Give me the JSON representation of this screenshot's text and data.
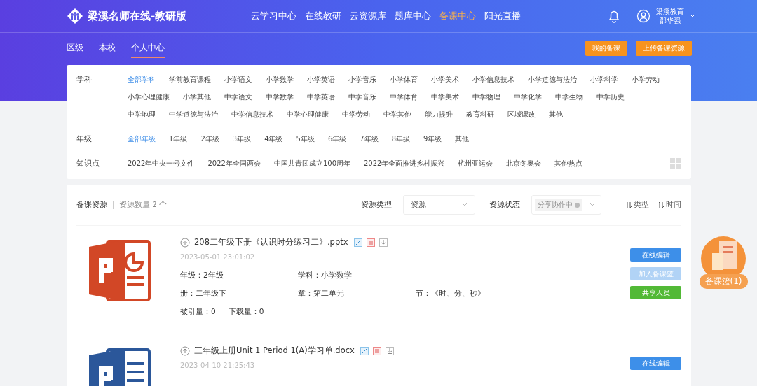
{
  "header": {
    "logo_text": "梁溪名师在线-教研版",
    "nav": [
      {
        "label": "云学习中心",
        "selected": false
      },
      {
        "label": "在线教研",
        "selected": false
      },
      {
        "label": "云资源库",
        "selected": false
      },
      {
        "label": "题库中心",
        "selected": false
      },
      {
        "label": "备课中心",
        "selected": true
      },
      {
        "label": "阳光直播",
        "selected": false
      }
    ],
    "user": {
      "org": "梁溪教育",
      "name": "邵华强"
    }
  },
  "subnav": {
    "tabs": [
      {
        "label": "区级",
        "selected": false
      },
      {
        "label": "本校",
        "selected": false
      },
      {
        "label": "个人中心",
        "selected": true
      }
    ],
    "actions": [
      "我的备课",
      "上传备课资源"
    ]
  },
  "filters": [
    {
      "label": "学科",
      "options": [
        {
          "label": "全部学科",
          "selected": true
        },
        {
          "label": "学前教育课程",
          "selected": false
        },
        {
          "label": "小学语文",
          "selected": false
        },
        {
          "label": "小学数学",
          "selected": false
        },
        {
          "label": "小学英语",
          "selected": false
        },
        {
          "label": "小学音乐",
          "selected": false
        },
        {
          "label": "小学体育",
          "selected": false
        },
        {
          "label": "小学美术",
          "selected": false
        },
        {
          "label": "小学信息技术",
          "selected": false
        },
        {
          "label": "小学道德与法治",
          "selected": false
        },
        {
          "label": "小学科学",
          "selected": false
        },
        {
          "label": "小学劳动",
          "selected": false
        },
        {
          "label": "小学心理健康",
          "selected": false
        },
        {
          "label": "小学其他",
          "selected": false
        },
        {
          "label": "中学语文",
          "selected": false
        },
        {
          "label": "中学数学",
          "selected": false
        },
        {
          "label": "中学英语",
          "selected": false
        },
        {
          "label": "中学音乐",
          "selected": false
        },
        {
          "label": "中学体育",
          "selected": false
        },
        {
          "label": "中学美术",
          "selected": false
        },
        {
          "label": "中学物理",
          "selected": false
        },
        {
          "label": "中学化学",
          "selected": false
        },
        {
          "label": "中学生物",
          "selected": false
        },
        {
          "label": "中学历史",
          "selected": false
        },
        {
          "label": "中学地理",
          "selected": false
        },
        {
          "label": "中学道德与法治",
          "selected": false
        },
        {
          "label": "中学信息技术",
          "selected": false
        },
        {
          "label": "中学心理健康",
          "selected": false
        },
        {
          "label": "中学劳动",
          "selected": false
        },
        {
          "label": "中学其他",
          "selected": false
        },
        {
          "label": "能力提升",
          "selected": false
        },
        {
          "label": "教育科研",
          "selected": false
        },
        {
          "label": "区域课改",
          "selected": false
        },
        {
          "label": "其他",
          "selected": false
        }
      ]
    },
    {
      "label": "年级",
      "options": [
        {
          "label": "全部年级",
          "selected": true
        },
        {
          "label": "1年级",
          "selected": false
        },
        {
          "label": "2年级",
          "selected": false
        },
        {
          "label": "3年级",
          "selected": false
        },
        {
          "label": "4年级",
          "selected": false
        },
        {
          "label": "5年级",
          "selected": false
        },
        {
          "label": "6年级",
          "selected": false
        },
        {
          "label": "7年级",
          "selected": false
        },
        {
          "label": "8年级",
          "selected": false
        },
        {
          "label": "9年级",
          "selected": false
        },
        {
          "label": "其他",
          "selected": false
        }
      ]
    },
    {
      "label": "知识点",
      "options": [
        {
          "label": "2022年中央一号文件",
          "selected": false
        },
        {
          "label": "2022年全国两会",
          "selected": false
        },
        {
          "label": "中国共青团成立100周年",
          "selected": false
        },
        {
          "label": "2022年全面推进乡村振兴",
          "selected": false
        },
        {
          "label": "杭州亚运会",
          "selected": false
        },
        {
          "label": "北京冬奥会",
          "selected": false
        },
        {
          "label": "其他热点",
          "selected": false
        }
      ]
    }
  ],
  "toolbar": {
    "title": "备课资源",
    "count": "资源数量 2 个",
    "type_label": "资源类型",
    "type_value": "资源",
    "status_label": "资源状态",
    "status_chip": "分享协作中",
    "sorts": [
      "类型",
      "时间"
    ]
  },
  "resources": [
    {
      "kind": "pptx",
      "title": "208二年级下册《认识时分练习二》.pptx",
      "date": "2023-05-01 23:01:02",
      "rows": [
        [
          "年级：2年级",
          "学科：小学数学"
        ],
        [
          "册：二年级下",
          "章：第二单元",
          "节：《时、分、秒》"
        ],
        [
          "被引量：0",
          "下载量：0"
        ]
      ],
      "buttons": [
        {
          "label": "在线编辑",
          "kind": "edit"
        },
        {
          "label": "加入备课篮",
          "kind": "disabled"
        },
        {
          "label": "共享人员",
          "kind": "share"
        }
      ]
    },
    {
      "kind": "docx",
      "title": "三年级上册Unit 1 Period 1(A)学习单.docx",
      "date": "2023-04-10 21:25:43",
      "buttons": [
        {
          "label": "在线编辑",
          "kind": "edit"
        }
      ]
    }
  ],
  "basket": {
    "label": "备课篮(1)"
  }
}
